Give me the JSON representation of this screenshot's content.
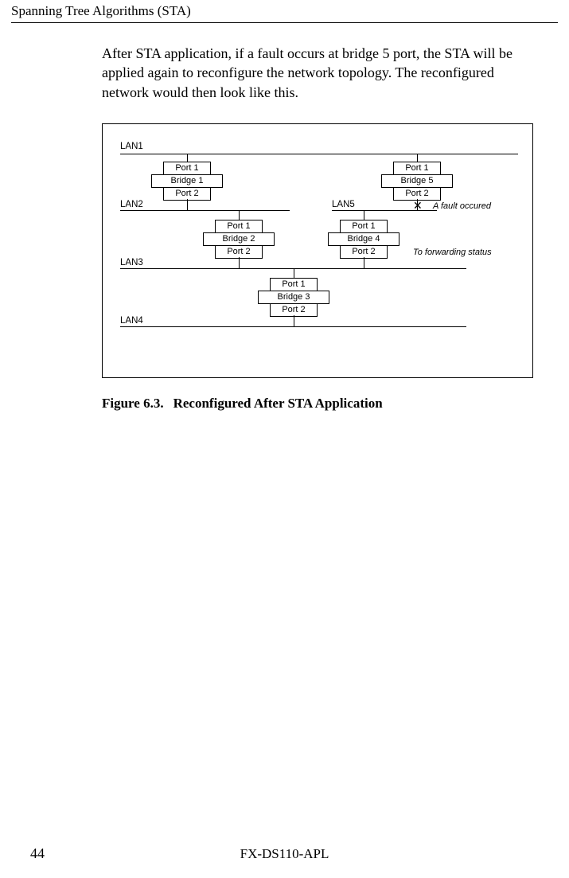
{
  "header": {
    "title": "Spanning Tree Algorithms (STA)"
  },
  "body": {
    "paragraph": "After STA application, if a fault occurs at bridge 5 port, the STA will be applied again to reconfigure the network topology.    The reconfigured network would then look like this."
  },
  "diagram": {
    "lans": {
      "lan1": "LAN1",
      "lan2": "LAN2",
      "lan3": "LAN3",
      "lan4": "LAN4",
      "lan5": "LAN5"
    },
    "bridges": {
      "b1": {
        "port1": "Port 1",
        "name": "Bridge 1",
        "port2": "Port 2"
      },
      "b2": {
        "port1": "Port 1",
        "name": "Bridge 2",
        "port2": "Port 2"
      },
      "b3": {
        "port1": "Port 1",
        "name": "Bridge 3",
        "port2": "Port 2"
      },
      "b4": {
        "port1": "Port 1",
        "name": "Bridge 4",
        "port2": "Port 2"
      },
      "b5": {
        "port1": "Port 1",
        "name": "Bridge 5",
        "port2": "Port 2"
      }
    },
    "annotations": {
      "fault": "A fault occured",
      "forwarding": "To forwarding status",
      "x": "✕"
    }
  },
  "caption": {
    "label": "Figure 6.3.",
    "title": "Reconfigured After STA Application"
  },
  "footer": {
    "page": "44",
    "model": "FX-DS110-APL"
  }
}
